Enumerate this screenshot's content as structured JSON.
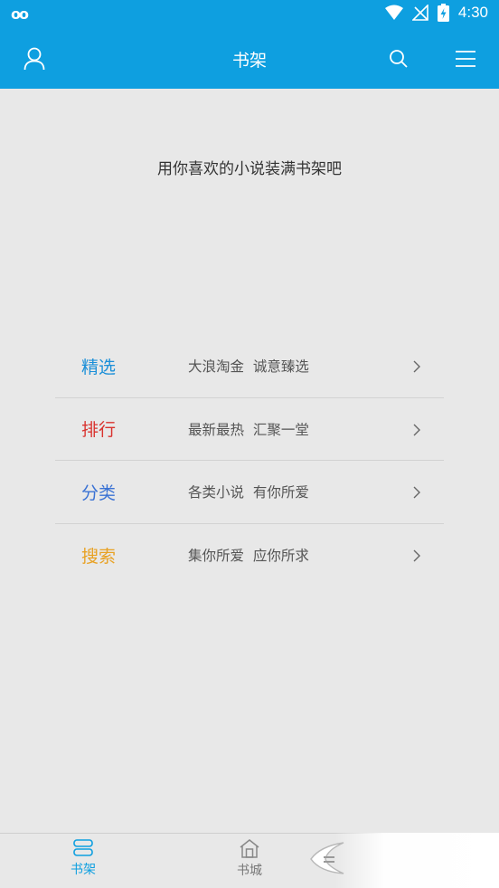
{
  "status_bar": {
    "left_glyph": "oo",
    "time": "4:30"
  },
  "app_bar": {
    "title": "书架",
    "icons": [
      "user-icon",
      "search-icon",
      "menu-icon"
    ]
  },
  "empty_hint": "用你喜欢的小说装满书架吧",
  "menu": [
    {
      "label": "精选",
      "desc": "大浪淘金  诚意臻选",
      "color": "#1b8fd8"
    },
    {
      "label": "排行",
      "desc": "最新最热  汇聚一堂",
      "color": "#d9322e"
    },
    {
      "label": "分类",
      "desc": "各类小说  有你所爱",
      "color": "#3a72d4"
    },
    {
      "label": "搜索",
      "desc": "集你所爱  应你所求",
      "color": "#e8a122"
    }
  ],
  "tabs": [
    {
      "label": "书架",
      "icon": "bookshelf-icon",
      "active": true
    },
    {
      "label": "书城",
      "icon": "store-icon",
      "active": false
    }
  ],
  "colors": {
    "primary": "#0e9fe0",
    "background": "#e8e8e8"
  }
}
